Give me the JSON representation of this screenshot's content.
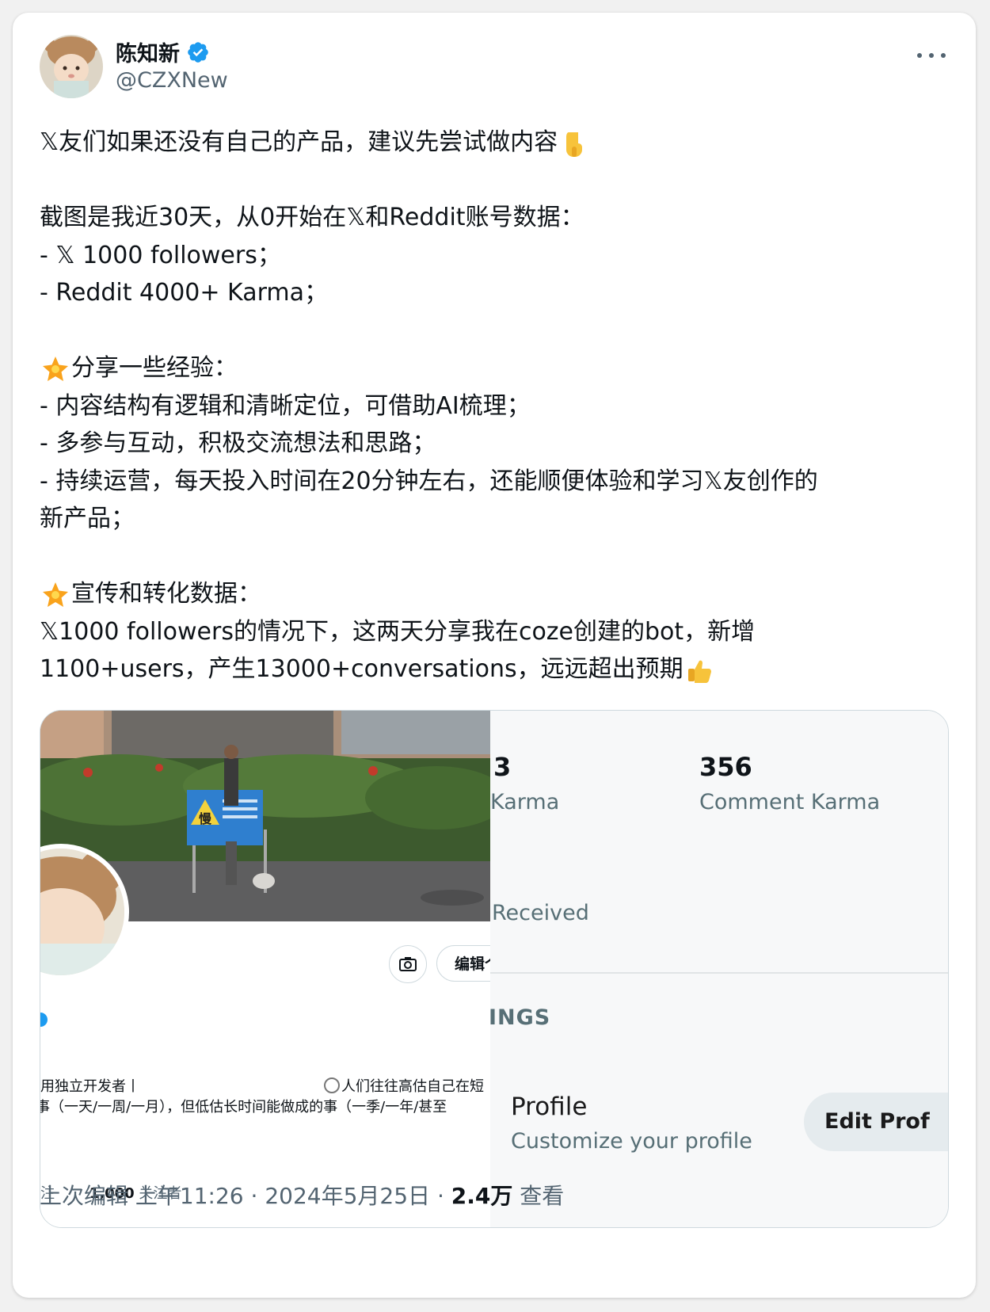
{
  "author": {
    "display_name": "陈知新",
    "handle": "@CZXNew",
    "verified_icon": "verified-badge-icon",
    "more_icon": "more-options-icon"
  },
  "tweet": {
    "line1": "𝕏友们如果还没有自己的产品，建议先尝试做内容",
    "line2": "截图是我近30天，从0开始在𝕏和Reddit账号数据：",
    "line3": "- 𝕏 1000 followers；",
    "line4": "- Reddit 4000+ Karma；",
    "line5": "分享一些经验：",
    "line6": "- 内容结构有逻辑和清晰定位，可借助AI梳理；",
    "line7": "- 多参与互动，积极交流想法和思路；",
    "line8": "- 持续运营，每天投入时间在20分钟左右，还能顺便体验和学习𝕏友创作的",
    "line9": "新产品；",
    "line10": "宣传和转化数据：",
    "line11": "𝕏1000 followers的情况下，这两天分享我在coze创建的bot，新增",
    "line12": "1100+users，产生13000+conversations，远远超出预期"
  },
  "media": {
    "left": {
      "sign_text": "慢",
      "edit_button": "编辑个",
      "bio_left": "用独立开发者丨",
      "bio_right": "人们往往高估自己在短",
      "bio_line2": "事（一天/一周/一月），但低估长时间能做成的事（一季/一年/甚至",
      "following_suffix": "注",
      "followers_count": "1,000",
      "followers_label": "关注者"
    },
    "right": {
      "post_karma_num": "3",
      "post_karma_label": "Karma",
      "comment_karma_num": "356",
      "comment_karma_label": "Comment Karma",
      "received_label": "Received",
      "settings_heading": "INGS",
      "profile_title": "Profile",
      "profile_sub": "Customize your profile",
      "edit_profile_button": "Edit Prof"
    }
  },
  "footer": {
    "edited": "上次编辑",
    "time": "上午11:26",
    "sep1": "·",
    "date": "2024年5月25日",
    "sep2": "·",
    "views_count": "2.4万",
    "views_label": "查看"
  }
}
